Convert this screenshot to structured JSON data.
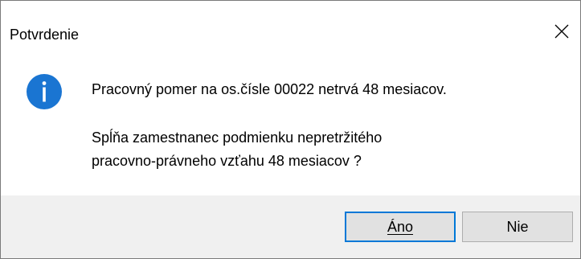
{
  "window": {
    "title": "Potvrdenie"
  },
  "icons": {
    "close": "close-icon",
    "message": "information-icon",
    "message_color": "#1a75d2"
  },
  "message": {
    "line1": "Pracovný pomer na os.čísle 00022 netrvá 48 mesiacov.",
    "line2a": "Spĺňa zamestnanec podmienku nepretržitého",
    "line2b": "pracovno-právneho vzťahu 48 mesiacov ?"
  },
  "buttons": {
    "yes_label": "Áno",
    "no_label": "Nie",
    "default_border_color": "#0078d7"
  }
}
